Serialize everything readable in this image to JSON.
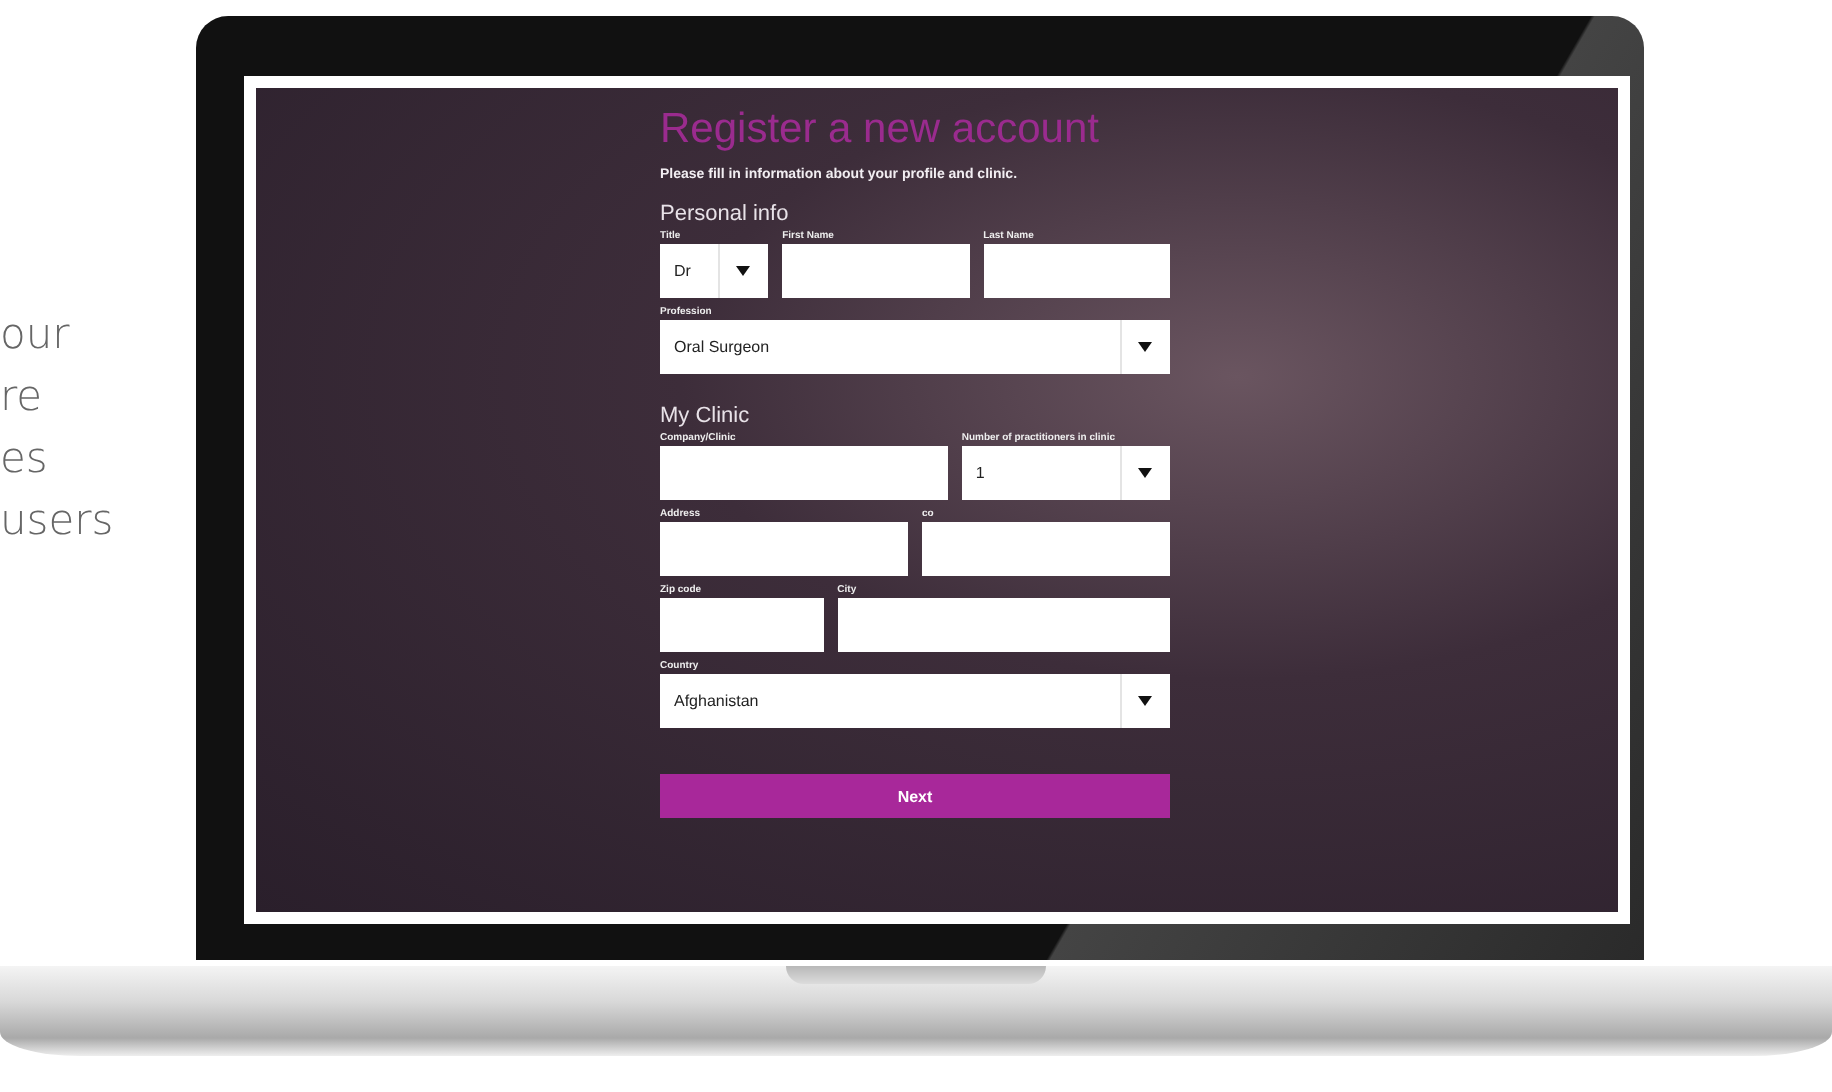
{
  "side_text": [
    "our",
    "re",
    "es",
    "users"
  ],
  "form": {
    "title": "Register a new account",
    "subtitle": "Please fill in information about your profile and clinic.",
    "sections": [
      {
        "heading": "Personal info",
        "rows": [
          {
            "fields": [
              {
                "label": "Title",
                "kind": "select",
                "value": "Dr"
              },
              {
                "label": "First Name",
                "kind": "text"
              },
              {
                "label": "Last Name",
                "kind": "text"
              }
            ]
          },
          {
            "fields": [
              {
                "label": "Profession",
                "kind": "select",
                "value": "Oral Surgeon"
              }
            ]
          }
        ]
      },
      {
        "heading": "My Clinic",
        "rows": [
          {
            "fields": [
              {
                "label": "Company/Clinic",
                "kind": "text"
              },
              {
                "label": "Number of practitioners in clinic",
                "kind": "select",
                "value": "1"
              }
            ]
          },
          {
            "fields": [
              {
                "label": "Address",
                "kind": "text"
              },
              {
                "label": "co",
                "kind": "text"
              }
            ]
          },
          {
            "fields": [
              {
                "label": "Zip code",
                "kind": "text"
              },
              {
                "label": "City",
                "kind": "text"
              }
            ]
          },
          {
            "fields": [
              {
                "label": "Country",
                "kind": "select",
                "value": "Afghanistan"
              }
            ]
          }
        ]
      }
    ],
    "button": "Next"
  }
}
